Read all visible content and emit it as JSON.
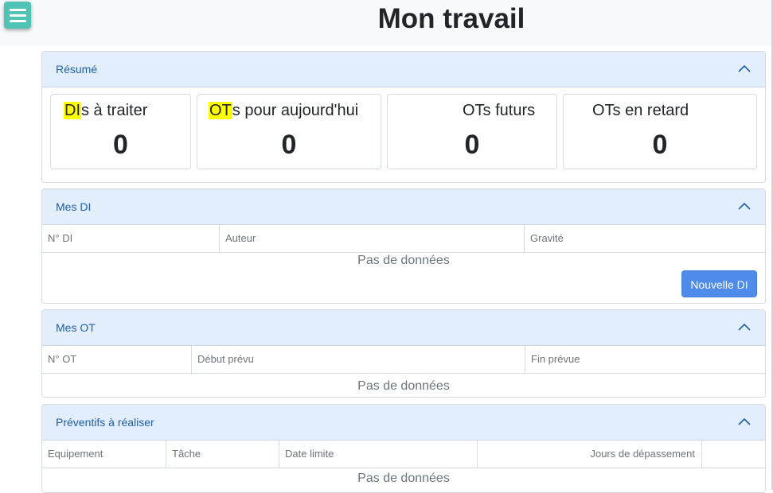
{
  "header": {
    "title": "Mon travail",
    "menu_icon": "hamburger-menu-icon"
  },
  "summary": {
    "title": "Résumé",
    "cards": [
      {
        "highlight": "DI",
        "label_rest": "s à traiter",
        "value": "0"
      },
      {
        "highlight": "OT",
        "label_rest": "s pour aujourd'hui",
        "value": "0"
      },
      {
        "label": "OTs futurs",
        "value": "0"
      },
      {
        "label": "OTs en retard",
        "value": "0"
      }
    ]
  },
  "mes_di": {
    "title": "Mes DI",
    "columns": [
      "N° DI",
      "Auteur",
      "Gravité"
    ],
    "empty_text": "Pas de données",
    "new_button": "Nouvelle DI"
  },
  "mes_ot": {
    "title": "Mes OT",
    "columns": [
      "N° OT",
      "Début prévu",
      "Fin prévue"
    ],
    "empty_text": "Pas de données"
  },
  "preventifs": {
    "title": "Préventifs à réaliser",
    "columns": [
      "Equipement",
      "Tâche",
      "Date limite",
      "Jours de dépassement",
      ""
    ],
    "empty_text": "Pas de données"
  },
  "colors": {
    "panel_header_bg": "#e3eefd",
    "panel_title": "#1e5fa8",
    "menu_button": "#4fc3b4",
    "primary_button": "#4f8bea",
    "highlight": "#ffff00"
  }
}
